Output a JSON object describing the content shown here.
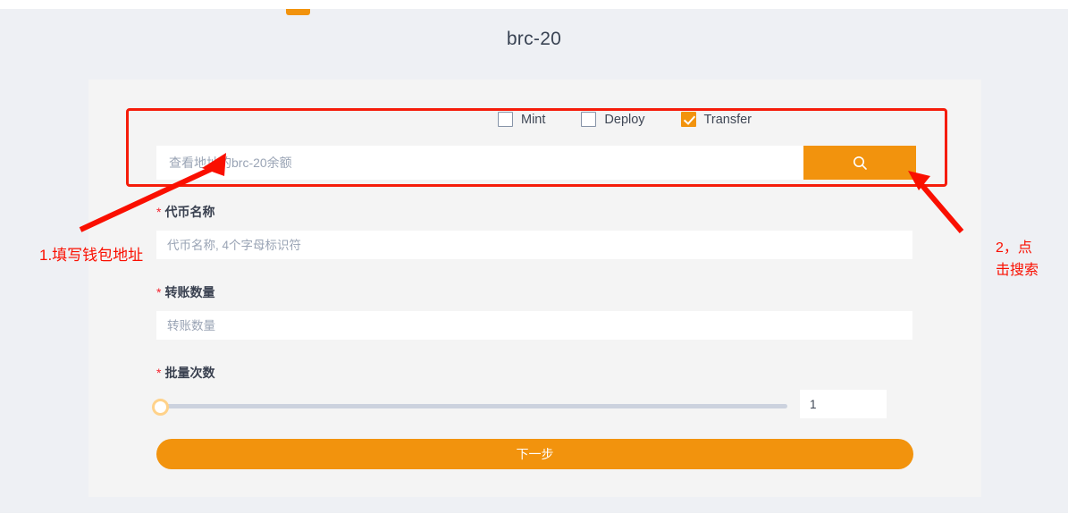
{
  "page": {
    "title": "brc-20",
    "background_color": "#eef0f4",
    "accent_color": "#f2930d",
    "annotation_color": "#fa0f00"
  },
  "type_options": [
    {
      "label": "Mint",
      "checked": false,
      "name": "mint"
    },
    {
      "label": "Deploy",
      "checked": false,
      "name": "deploy"
    },
    {
      "label": "Transfer",
      "checked": true,
      "name": "transfer"
    }
  ],
  "search": {
    "placeholder": "查看地址的brc-20余额",
    "value": "",
    "button_icon": "search-icon"
  },
  "form": {
    "token_name": {
      "label": "代币名称",
      "required_mark": "*",
      "placeholder": "代币名称, 4个字母标识符",
      "value": ""
    },
    "transfer_amount": {
      "label": "转账数量",
      "required_mark": "*",
      "placeholder": "转账数量",
      "value": ""
    },
    "batch_count": {
      "label": "批量次数",
      "required_mark": "*",
      "value": "1",
      "slider_min": 1,
      "slider_max": 100,
      "slider_position_percent": 0
    },
    "submit_label": "下一步"
  },
  "annotations": {
    "left": "1.填写钱包地址",
    "right_line1": "2，点",
    "right_line2": "击搜索"
  }
}
